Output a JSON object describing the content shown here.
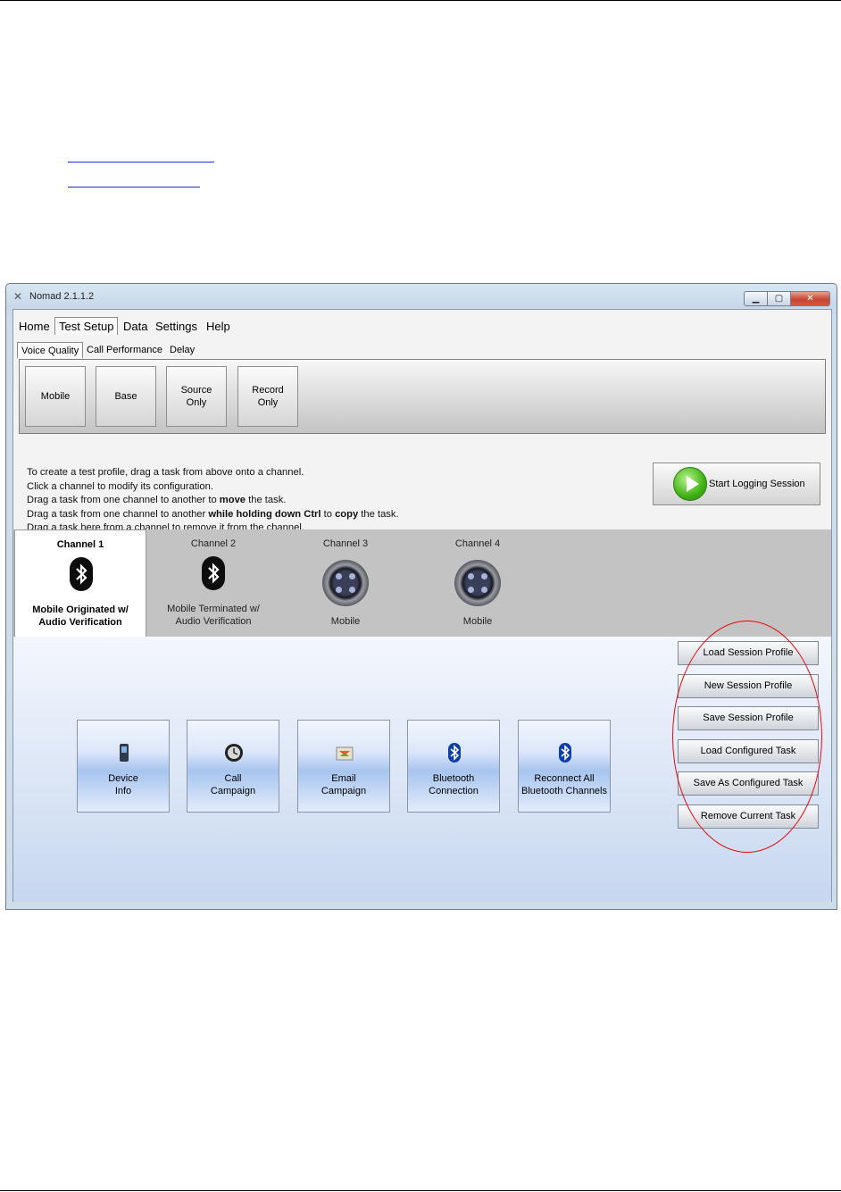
{
  "window": {
    "title": "Nomad 2.1.1.2"
  },
  "menu": [
    "Home",
    "Test Setup",
    "Data",
    "Settings",
    "Help"
  ],
  "subtabs": [
    "Voice Quality",
    "Call Performance",
    "Delay"
  ],
  "ribbon_buttons": [
    "Mobile",
    "Base",
    "Source\nOnly",
    "Record\nOnly"
  ],
  "instructions": {
    "line1": "To create a test profile, drag a task from above onto a channel.",
    "line2": "Click a channel to modify its configuration.",
    "line3_pre": "Drag a task from one channel to another to ",
    "line3_bold": "move",
    "line3_post": " the task.",
    "line4_pre": "Drag a task from one channel to another ",
    "line4_bold1": "while holding down Ctrl",
    "line4_mid": " to ",
    "line4_bold2": "copy",
    "line4_post": " the task.",
    "line5": "Drag a task here from a channel to remove it from the channel."
  },
  "start_button": "Start Logging Session",
  "channels": [
    {
      "title": "Channel 1",
      "desc": "Mobile Originated w/\nAudio Verification"
    },
    {
      "title": "Channel 2",
      "desc": "Mobile Terminated w/\nAudio Verification"
    },
    {
      "title": "Channel 3",
      "desc": "Mobile"
    },
    {
      "title": "Channel 4",
      "desc": "Mobile"
    }
  ],
  "tasks": [
    "Device\nInfo",
    "Call\nCampaign",
    "Email\nCampaign",
    "Bluetooth\nConnection",
    "Reconnect All\nBluetooth Channels"
  ],
  "side_buttons": [
    "Load Session Profile",
    "New Session Profile",
    "Save Session Profile",
    "Load Configured Task",
    "Save As Configured Task",
    "Remove Current Task"
  ],
  "icons": [
    "minimize-icon",
    "maximize-icon",
    "close-icon",
    "play-icon",
    "bluetooth-icon",
    "audio-jack-icon",
    "phone-icon",
    "clock-icon",
    "email-icon"
  ],
  "colors": {
    "highlight_oval": "#e30a0a",
    "link": "#1a33cc",
    "play": "#3fb313"
  }
}
